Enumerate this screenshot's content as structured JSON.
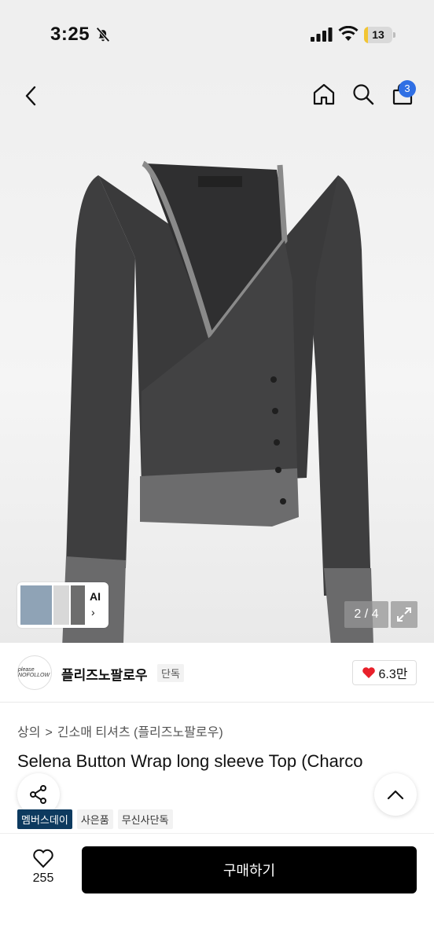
{
  "status_bar": {
    "time": "3:25",
    "battery_level": "13",
    "battery_fraction": 0.13
  },
  "header": {
    "cart_count": "3"
  },
  "gallery": {
    "counter": "2 / 4",
    "ai_label": "AI",
    "ai_chevron": "›"
  },
  "brand": {
    "name": "플리즈노팔로우",
    "tag": "단독",
    "likes": "6.3만",
    "logo_text": "please NOFOLLOW"
  },
  "breadcrumb": {
    "category": "상의",
    "separator": ">",
    "subcategory": "긴소매 티셔츠 (플리즈노팔로우)"
  },
  "product": {
    "title": "Selena Button Wrap long sleeve Top (Charco"
  },
  "tags": [
    "멤버스데이",
    "사은품",
    "무신사단독"
  ],
  "bottom": {
    "wishlist_count": "255",
    "buy_label": "구매하기"
  },
  "colors": {
    "badge": "#2f6fe4",
    "heart": "#e8202a",
    "tag_primary": "#0d3a5f",
    "buy": "#000000",
    "battery": "#f2c533"
  },
  "icons": [
    "bell-slash-icon",
    "signal-icon",
    "wifi-icon",
    "battery-icon",
    "chevron-left-icon",
    "home-icon",
    "search-icon",
    "bag-icon",
    "expand-icon",
    "heart-icon",
    "share-icon",
    "chevron-up-icon"
  ]
}
